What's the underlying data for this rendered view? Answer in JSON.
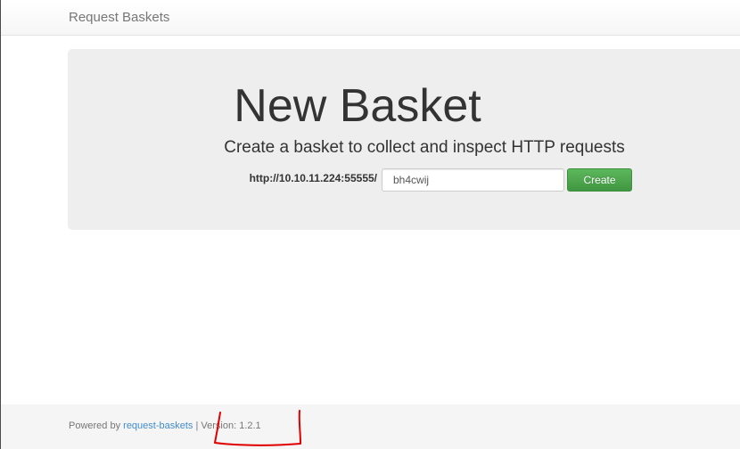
{
  "navbar": {
    "brand": "Request Baskets"
  },
  "jumbotron": {
    "title": "New Basket",
    "lead": "Create a basket to collect and inspect HTTP requests",
    "url_prefix": "http://10.10.11.224:55555/",
    "basket_name_value": "bh4cwij",
    "create_label": "Create"
  },
  "footer": {
    "powered_by": "Powered by ",
    "link_text": "request-baskets",
    "separator": " | ",
    "version": "Version: 1.2.1"
  },
  "colors": {
    "create_button": "#5cb85c",
    "link": "#428bca",
    "jumbotron_bg": "#eeeeee",
    "annotation_stroke": "#e00000"
  }
}
